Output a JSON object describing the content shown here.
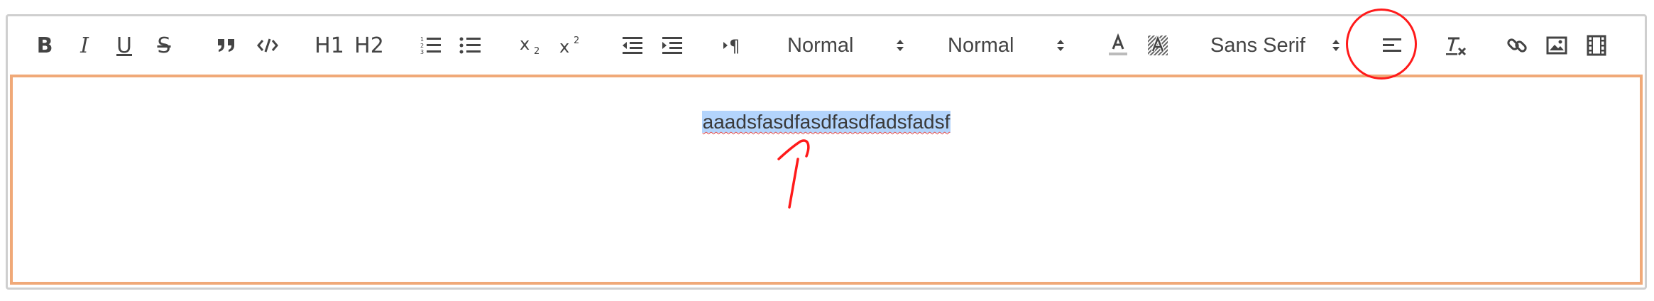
{
  "toolbar": {
    "header_1": "H1",
    "header_2": "H2",
    "size_picker": "Normal",
    "header_picker": "Normal",
    "font_picker": "Sans Serif"
  },
  "editor": {
    "content": "aaadsfasdfasdfasdfadsfadsf"
  },
  "colors": {
    "toolbar_icon": "#444444",
    "editor_focus_border": "#f0a978",
    "selection_highlight": "#b3d4fc",
    "annotation": "#ff1a1a"
  }
}
